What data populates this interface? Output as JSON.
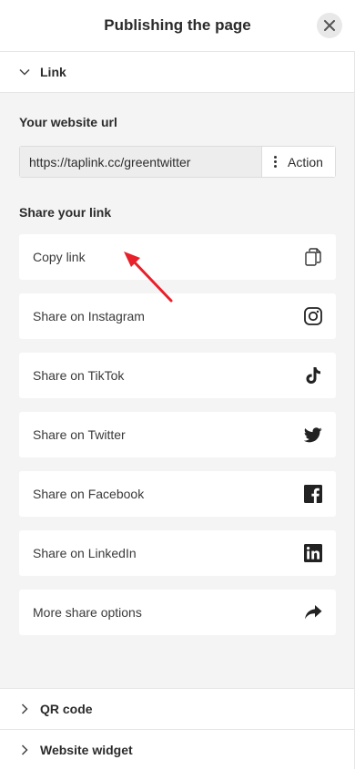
{
  "header": {
    "title": "Publishing the page"
  },
  "link_section": {
    "label": "Link"
  },
  "website_url": {
    "label": "Your website url",
    "value": "https://taplink.cc/greentwitter",
    "action_label": "Action"
  },
  "share": {
    "label": "Share your link",
    "items": [
      {
        "label": "Copy link",
        "icon": "copy-icon"
      },
      {
        "label": "Share on Instagram",
        "icon": "instagram-icon"
      },
      {
        "label": "Share on TikTok",
        "icon": "tiktok-icon"
      },
      {
        "label": "Share on Twitter",
        "icon": "twitter-icon"
      },
      {
        "label": "Share on Facebook",
        "icon": "facebook-icon"
      },
      {
        "label": "Share on LinkedIn",
        "icon": "linkedin-icon"
      },
      {
        "label": "More share options",
        "icon": "share-arrow-icon"
      }
    ]
  },
  "sections": {
    "qr_code": "QR code",
    "website_widget": "Website widget"
  },
  "colors": {
    "annotation_arrow": "#e8202a",
    "panel_bg": "#f4f4f5"
  }
}
